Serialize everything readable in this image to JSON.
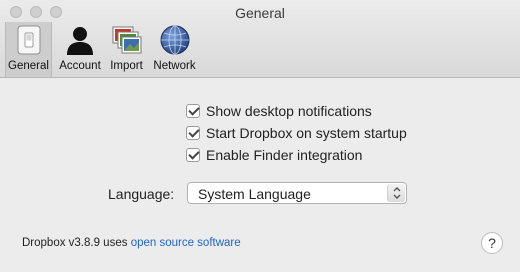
{
  "window": {
    "title": "General"
  },
  "tabs": [
    {
      "label": "General",
      "icon": "switch-icon",
      "selected": true
    },
    {
      "label": "Account",
      "icon": "person-icon"
    },
    {
      "label": "Import",
      "icon": "photos-icon"
    },
    {
      "label": "Network",
      "icon": "globe-icon"
    }
  ],
  "settings": {
    "checkboxes": [
      {
        "label": "Show desktop notifications",
        "checked": true
      },
      {
        "label": "Start Dropbox on system startup",
        "checked": true
      },
      {
        "label": "Enable Finder integration",
        "checked": true
      }
    ],
    "language_label": "Language:",
    "language_value": "System Language"
  },
  "footer": {
    "version_text": "Dropbox v3.8.9 uses",
    "link_text": "open source software",
    "help_label": "?"
  },
  "colors": {
    "link": "#1f64c8",
    "background": "#ececec"
  }
}
